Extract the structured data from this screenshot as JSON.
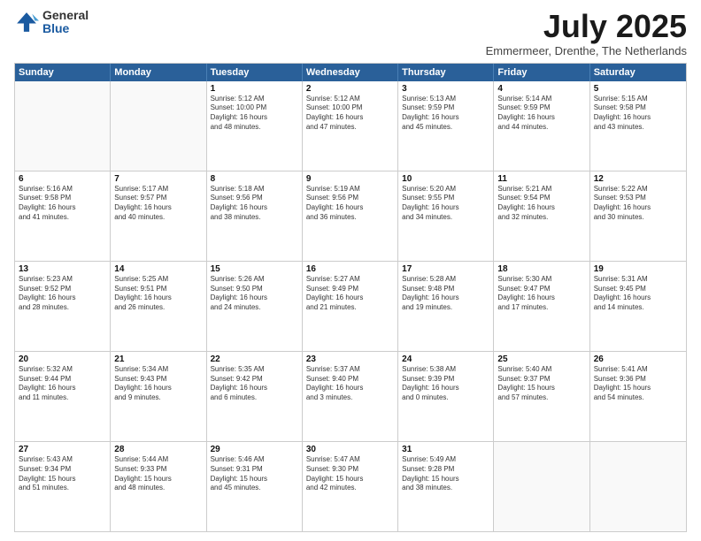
{
  "logo": {
    "general": "General",
    "blue": "Blue"
  },
  "header": {
    "month": "July 2025",
    "location": "Emmermeer, Drenthe, The Netherlands"
  },
  "weekdays": [
    "Sunday",
    "Monday",
    "Tuesday",
    "Wednesday",
    "Thursday",
    "Friday",
    "Saturday"
  ],
  "rows": [
    [
      {
        "day": "",
        "empty": true
      },
      {
        "day": "",
        "empty": true
      },
      {
        "day": "1",
        "lines": [
          "Sunrise: 5:12 AM",
          "Sunset: 10:00 PM",
          "Daylight: 16 hours",
          "and 48 minutes."
        ]
      },
      {
        "day": "2",
        "lines": [
          "Sunrise: 5:12 AM",
          "Sunset: 10:00 PM",
          "Daylight: 16 hours",
          "and 47 minutes."
        ]
      },
      {
        "day": "3",
        "lines": [
          "Sunrise: 5:13 AM",
          "Sunset: 9:59 PM",
          "Daylight: 16 hours",
          "and 45 minutes."
        ]
      },
      {
        "day": "4",
        "lines": [
          "Sunrise: 5:14 AM",
          "Sunset: 9:59 PM",
          "Daylight: 16 hours",
          "and 44 minutes."
        ]
      },
      {
        "day": "5",
        "lines": [
          "Sunrise: 5:15 AM",
          "Sunset: 9:58 PM",
          "Daylight: 16 hours",
          "and 43 minutes."
        ]
      }
    ],
    [
      {
        "day": "6",
        "lines": [
          "Sunrise: 5:16 AM",
          "Sunset: 9:58 PM",
          "Daylight: 16 hours",
          "and 41 minutes."
        ]
      },
      {
        "day": "7",
        "lines": [
          "Sunrise: 5:17 AM",
          "Sunset: 9:57 PM",
          "Daylight: 16 hours",
          "and 40 minutes."
        ]
      },
      {
        "day": "8",
        "lines": [
          "Sunrise: 5:18 AM",
          "Sunset: 9:56 PM",
          "Daylight: 16 hours",
          "and 38 minutes."
        ]
      },
      {
        "day": "9",
        "lines": [
          "Sunrise: 5:19 AM",
          "Sunset: 9:56 PM",
          "Daylight: 16 hours",
          "and 36 minutes."
        ]
      },
      {
        "day": "10",
        "lines": [
          "Sunrise: 5:20 AM",
          "Sunset: 9:55 PM",
          "Daylight: 16 hours",
          "and 34 minutes."
        ]
      },
      {
        "day": "11",
        "lines": [
          "Sunrise: 5:21 AM",
          "Sunset: 9:54 PM",
          "Daylight: 16 hours",
          "and 32 minutes."
        ]
      },
      {
        "day": "12",
        "lines": [
          "Sunrise: 5:22 AM",
          "Sunset: 9:53 PM",
          "Daylight: 16 hours",
          "and 30 minutes."
        ]
      }
    ],
    [
      {
        "day": "13",
        "lines": [
          "Sunrise: 5:23 AM",
          "Sunset: 9:52 PM",
          "Daylight: 16 hours",
          "and 28 minutes."
        ]
      },
      {
        "day": "14",
        "lines": [
          "Sunrise: 5:25 AM",
          "Sunset: 9:51 PM",
          "Daylight: 16 hours",
          "and 26 minutes."
        ]
      },
      {
        "day": "15",
        "lines": [
          "Sunrise: 5:26 AM",
          "Sunset: 9:50 PM",
          "Daylight: 16 hours",
          "and 24 minutes."
        ]
      },
      {
        "day": "16",
        "lines": [
          "Sunrise: 5:27 AM",
          "Sunset: 9:49 PM",
          "Daylight: 16 hours",
          "and 21 minutes."
        ]
      },
      {
        "day": "17",
        "lines": [
          "Sunrise: 5:28 AM",
          "Sunset: 9:48 PM",
          "Daylight: 16 hours",
          "and 19 minutes."
        ]
      },
      {
        "day": "18",
        "lines": [
          "Sunrise: 5:30 AM",
          "Sunset: 9:47 PM",
          "Daylight: 16 hours",
          "and 17 minutes."
        ]
      },
      {
        "day": "19",
        "lines": [
          "Sunrise: 5:31 AM",
          "Sunset: 9:45 PM",
          "Daylight: 16 hours",
          "and 14 minutes."
        ]
      }
    ],
    [
      {
        "day": "20",
        "lines": [
          "Sunrise: 5:32 AM",
          "Sunset: 9:44 PM",
          "Daylight: 16 hours",
          "and 11 minutes."
        ]
      },
      {
        "day": "21",
        "lines": [
          "Sunrise: 5:34 AM",
          "Sunset: 9:43 PM",
          "Daylight: 16 hours",
          "and 9 minutes."
        ]
      },
      {
        "day": "22",
        "lines": [
          "Sunrise: 5:35 AM",
          "Sunset: 9:42 PM",
          "Daylight: 16 hours",
          "and 6 minutes."
        ]
      },
      {
        "day": "23",
        "lines": [
          "Sunrise: 5:37 AM",
          "Sunset: 9:40 PM",
          "Daylight: 16 hours",
          "and 3 minutes."
        ]
      },
      {
        "day": "24",
        "lines": [
          "Sunrise: 5:38 AM",
          "Sunset: 9:39 PM",
          "Daylight: 16 hours",
          "and 0 minutes."
        ]
      },
      {
        "day": "25",
        "lines": [
          "Sunrise: 5:40 AM",
          "Sunset: 9:37 PM",
          "Daylight: 15 hours",
          "and 57 minutes."
        ]
      },
      {
        "day": "26",
        "lines": [
          "Sunrise: 5:41 AM",
          "Sunset: 9:36 PM",
          "Daylight: 15 hours",
          "and 54 minutes."
        ]
      }
    ],
    [
      {
        "day": "27",
        "lines": [
          "Sunrise: 5:43 AM",
          "Sunset: 9:34 PM",
          "Daylight: 15 hours",
          "and 51 minutes."
        ]
      },
      {
        "day": "28",
        "lines": [
          "Sunrise: 5:44 AM",
          "Sunset: 9:33 PM",
          "Daylight: 15 hours",
          "and 48 minutes."
        ]
      },
      {
        "day": "29",
        "lines": [
          "Sunrise: 5:46 AM",
          "Sunset: 9:31 PM",
          "Daylight: 15 hours",
          "and 45 minutes."
        ]
      },
      {
        "day": "30",
        "lines": [
          "Sunrise: 5:47 AM",
          "Sunset: 9:30 PM",
          "Daylight: 15 hours",
          "and 42 minutes."
        ]
      },
      {
        "day": "31",
        "lines": [
          "Sunrise: 5:49 AM",
          "Sunset: 9:28 PM",
          "Daylight: 15 hours",
          "and 38 minutes."
        ]
      },
      {
        "day": "",
        "empty": true
      },
      {
        "day": "",
        "empty": true
      }
    ]
  ]
}
